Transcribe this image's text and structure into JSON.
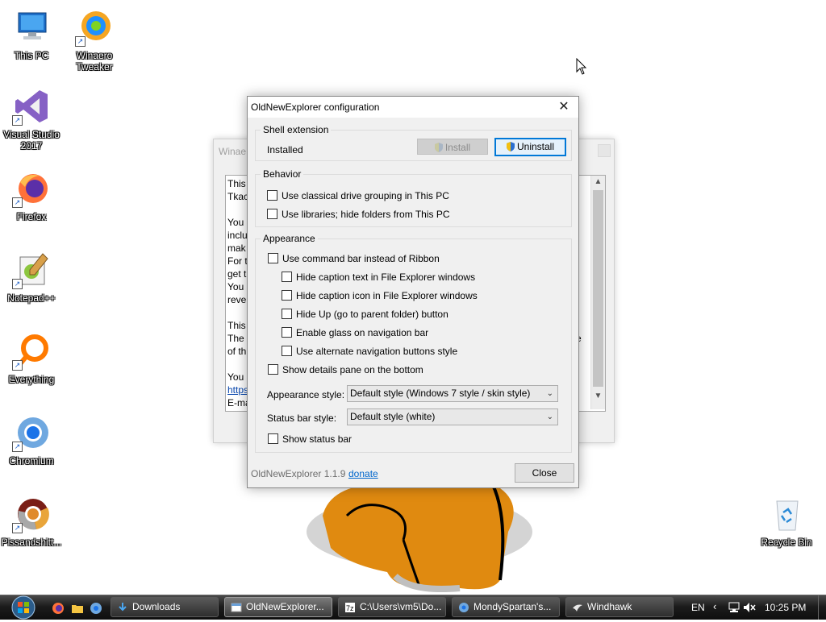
{
  "desktop": {
    "icons": [
      {
        "label": "This PC",
        "icon": "computer-icon"
      },
      {
        "label": "Winaero Tweaker",
        "icon": "winaero-tweaker-icon"
      },
      {
        "label": "Visual Studio 2017",
        "icon": "visual-studio-icon"
      },
      {
        "label": "Firefox",
        "icon": "firefox-icon"
      },
      {
        "label": "Notepad++",
        "icon": "notepad-plus-plus-icon"
      },
      {
        "label": "Everything",
        "icon": "everything-search-icon"
      },
      {
        "label": "Chromium",
        "icon": "chromium-icon"
      },
      {
        "label": "Pissandshitt...",
        "icon": "chrome-variant-icon"
      },
      {
        "label": "Recycle Bin",
        "icon": "recycle-bin-icon"
      }
    ]
  },
  "background_window": {
    "title": "Winae",
    "lines": [
      "This",
      "Tkac",
      "",
      "You",
      "inclu",
      "mak",
      "For t",
      "get t",
      "You",
      "reve",
      "",
      "This",
      "The",
      "of th",
      "",
      "You",
      "https",
      "E-ma"
    ],
    "side_fragment": "e"
  },
  "dialog": {
    "title": "OldNewExplorer configuration",
    "shell_extension": {
      "group_label": "Shell extension",
      "status": "Installed",
      "install_label": "Install",
      "uninstall_label": "Uninstall"
    },
    "behavior": {
      "group_label": "Behavior",
      "options": [
        {
          "label": "Use classical drive grouping in This PC",
          "checked": false
        },
        {
          "label": "Use libraries; hide folders from This PC",
          "checked": false
        }
      ]
    },
    "appearance": {
      "group_label": "Appearance",
      "command_bar": {
        "label": "Use command bar instead of Ribbon",
        "checked": false
      },
      "sub_options": [
        {
          "label": "Hide caption text in File Explorer windows",
          "checked": false
        },
        {
          "label": "Hide caption icon in File Explorer windows",
          "checked": false
        },
        {
          "label": "Hide Up (go to parent folder) button",
          "checked": false
        },
        {
          "label": "Enable glass on navigation bar",
          "checked": false
        },
        {
          "label": "Use alternate navigation buttons style",
          "checked": false
        }
      ],
      "details_pane": {
        "label": "Show details pane on the bottom",
        "checked": false
      },
      "appearance_style_label": "Appearance style:",
      "appearance_style_value": "Default style (Windows 7 style / skin style)",
      "status_bar_style_label": "Status bar style:",
      "status_bar_style_value": "Default style (white)",
      "show_status_bar": {
        "label": "Show status bar",
        "checked": false
      }
    },
    "footer": {
      "version": "OldNewExplorer 1.1.9",
      "donate_link": "donate",
      "close_label": "Close"
    }
  },
  "taskbar": {
    "quick_launch": [
      "firefox-icon",
      "folder-icon",
      "chromium-icon"
    ],
    "tasks": [
      {
        "label": "Downloads",
        "icon": "downloads-folder-icon",
        "active": false
      },
      {
        "label": "OldNewExplorer...",
        "icon": "app-window-icon",
        "active": true
      },
      {
        "label": "C:\\Users\\vm5\\Do...",
        "icon": "7zip-icon",
        "active": false
      },
      {
        "label": "MondySpartan's...",
        "icon": "chromium-icon",
        "active": false
      },
      {
        "label": "Windhawk",
        "icon": "windhawk-icon",
        "active": false
      }
    ],
    "tray": {
      "language": "EN",
      "time": "10:25 PM"
    }
  }
}
